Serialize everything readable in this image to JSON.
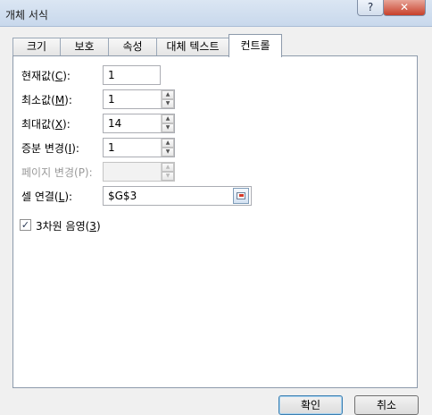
{
  "window": {
    "title": "개체 서식",
    "help_label": "?",
    "close_label": "✕"
  },
  "tabs": [
    {
      "label": "크기"
    },
    {
      "label": "보호"
    },
    {
      "label": "속성"
    },
    {
      "label": "대체 텍스트"
    },
    {
      "label": "컨트롤"
    }
  ],
  "active_tab": "컨트롤",
  "fields": {
    "current_value": {
      "label_text": "현재값(",
      "label_key": "C",
      "label_end": "):",
      "value": "1"
    },
    "min_value": {
      "label_text": "최소값(",
      "label_key": "M",
      "label_end": "):",
      "value": "1"
    },
    "max_value": {
      "label_text": "최대값(",
      "label_key": "X",
      "label_end": "):",
      "value": "14"
    },
    "increment": {
      "label_text": "증분 변경(",
      "label_key": "I",
      "label_end": "):",
      "value": "1"
    },
    "page_change": {
      "label_text": "페이지 변경(P):",
      "value": ""
    },
    "cell_link": {
      "label_text": "셀 연결(",
      "label_key": "L",
      "label_end": "):",
      "value": "$G$3"
    }
  },
  "shading_3d": {
    "label_text": "3차원 음영(",
    "label_key": "3",
    "label_end": ")",
    "checked": true,
    "check_glyph": "✓"
  },
  "buttons": {
    "ok": "확인",
    "cancel": "취소"
  }
}
